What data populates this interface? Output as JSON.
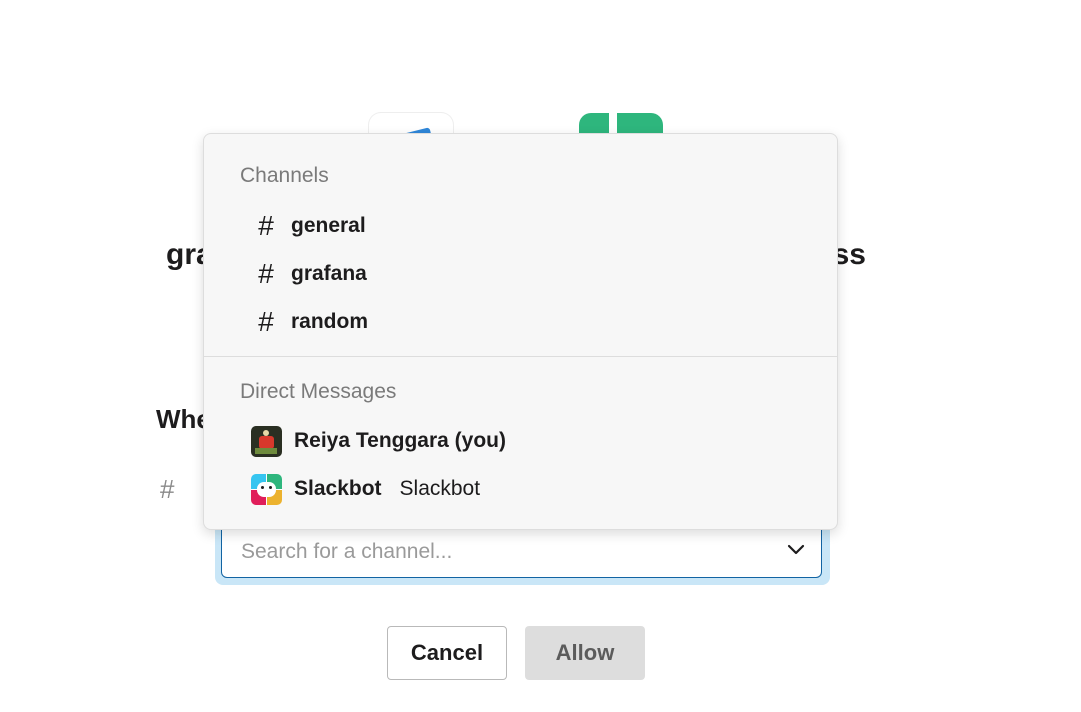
{
  "page": {
    "heading_left": "gra",
    "heading_right": "ss",
    "question": "Whe",
    "hash_prefix": "#"
  },
  "select": {
    "placeholder": "Search for a channel...",
    "chevron_icon": "chevron-down-icon"
  },
  "buttons": {
    "cancel_label": "Cancel",
    "allow_label": "Allow"
  },
  "dropdown": {
    "channels_header": "Channels",
    "channels": [
      {
        "name": "general",
        "icon": "#"
      },
      {
        "name": "grafana",
        "icon": "#"
      },
      {
        "name": "random",
        "icon": "#"
      }
    ],
    "dm_header": "Direct Messages",
    "direct_messages": [
      {
        "name": "Reiya Tenggara (you)",
        "secondary": ""
      },
      {
        "name": "Slackbot",
        "secondary": "Slackbot"
      }
    ]
  },
  "colors": {
    "accent_blue": "#1264a3",
    "focus_ring": "#c9e6f7",
    "app_green": "#2eb67d",
    "app_blue": "#2f87d9"
  }
}
